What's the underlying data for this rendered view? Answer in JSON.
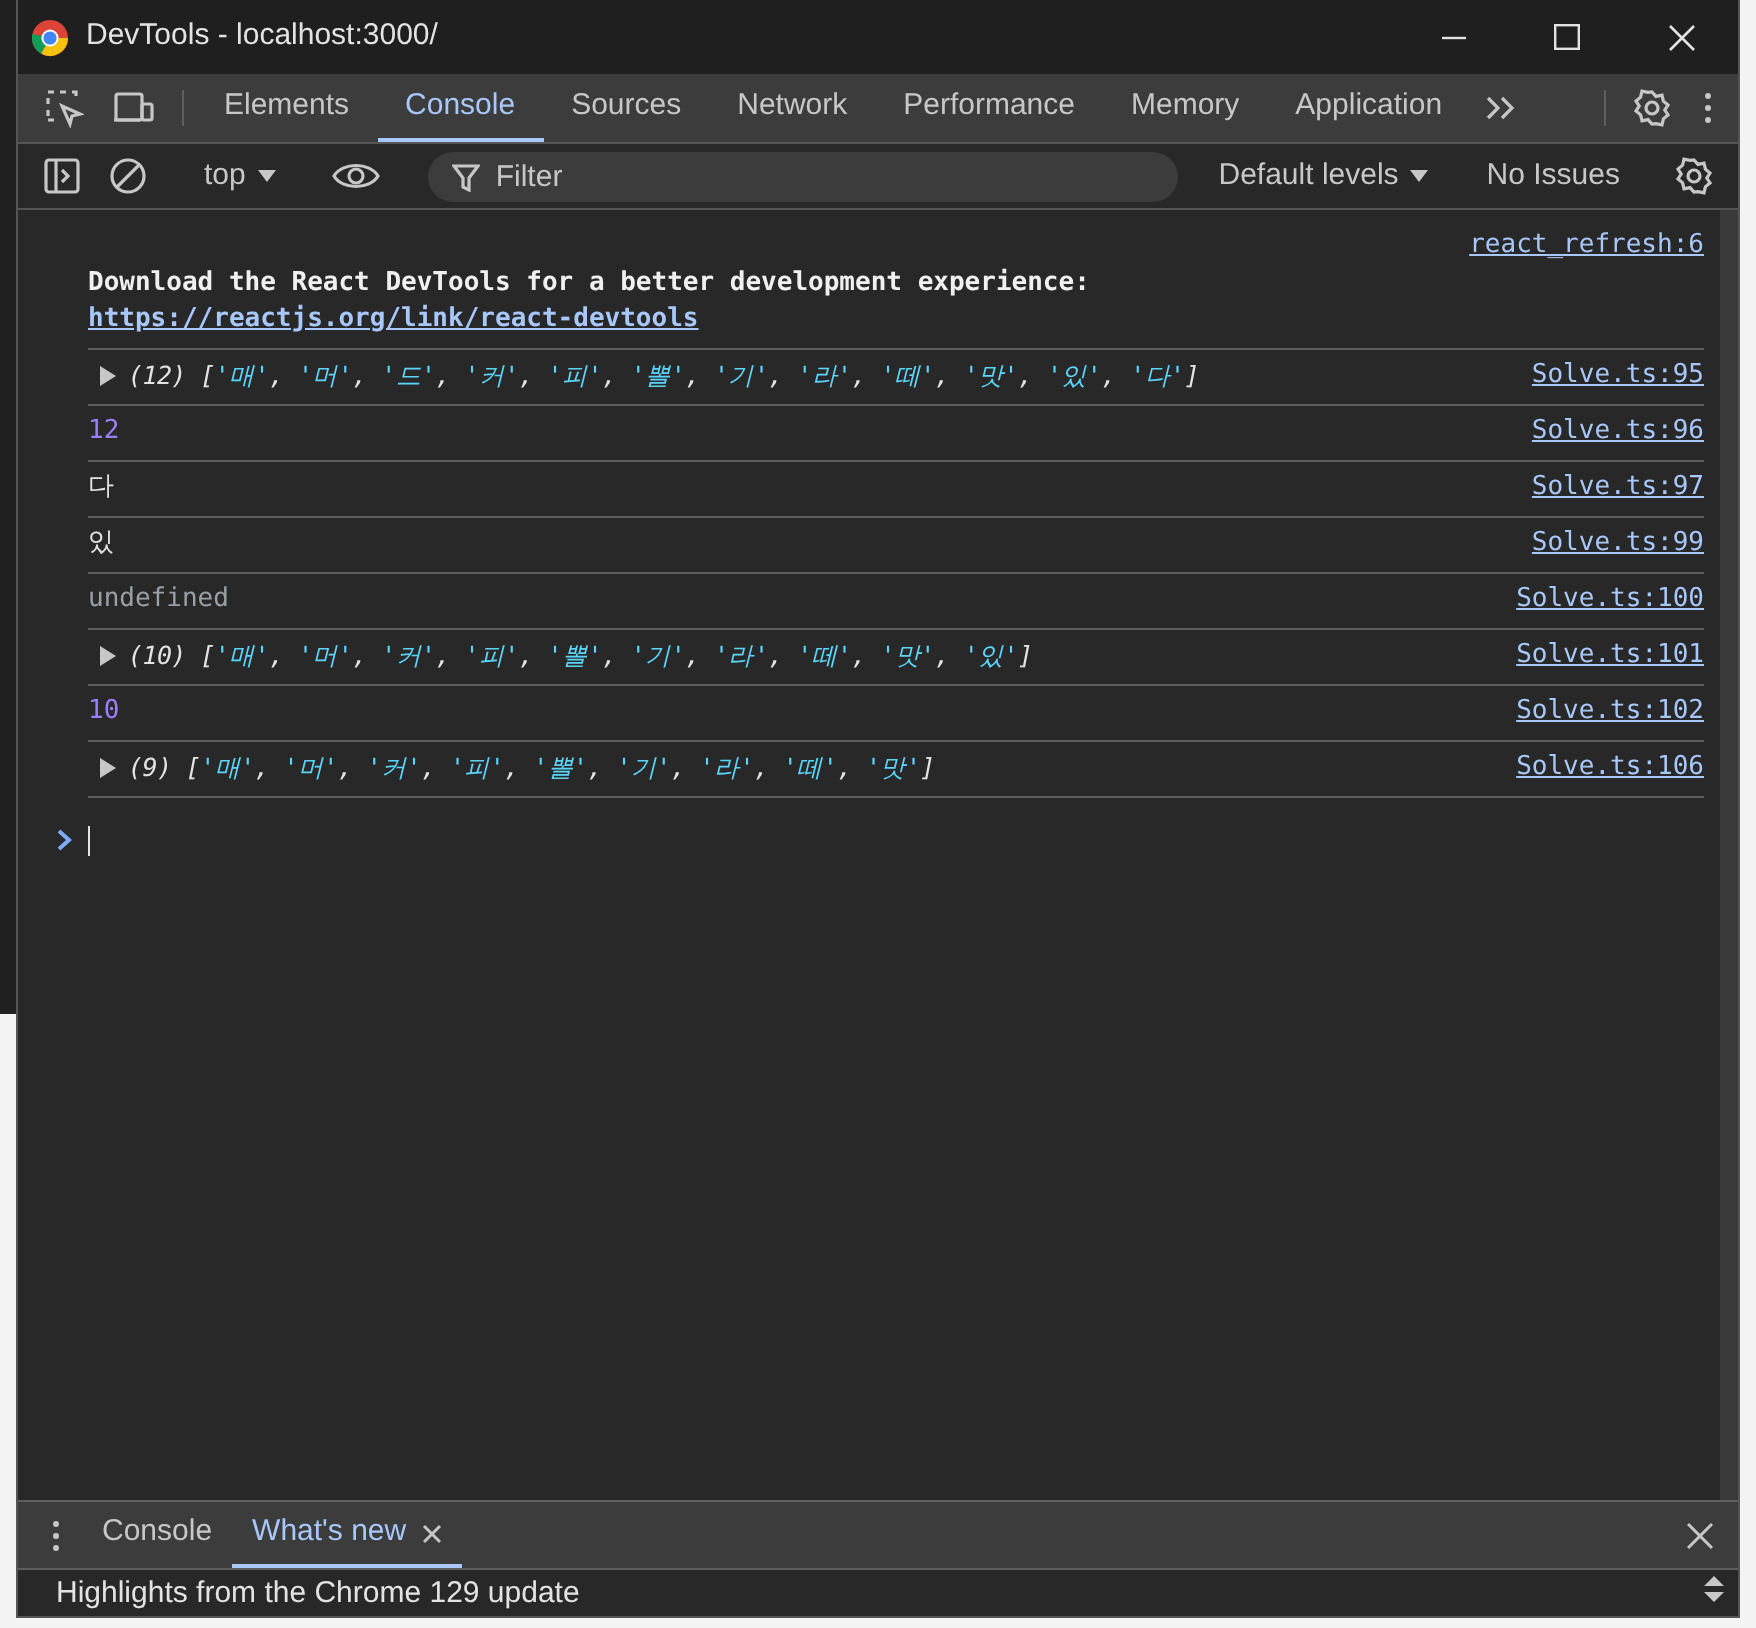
{
  "window": {
    "title": "DevTools - localhost:3000/"
  },
  "tabs": [
    {
      "label": "Elements",
      "selected": false
    },
    {
      "label": "Console",
      "selected": true
    },
    {
      "label": "Sources",
      "selected": false
    },
    {
      "label": "Network",
      "selected": false
    },
    {
      "label": "Performance",
      "selected": false
    },
    {
      "label": "Memory",
      "selected": false
    },
    {
      "label": "Application",
      "selected": false
    }
  ],
  "toolbar": {
    "context": "top",
    "filter": {
      "placeholder": "Filter"
    },
    "levels": "Default levels",
    "issues": "No Issues"
  },
  "console": {
    "entries": [
      {
        "kind": "message",
        "source": "react_refresh:6",
        "text": "Download the React DevTools for a better development experience:",
        "link": "https://reactjs.org/link/react-devtools"
      },
      {
        "kind": "array",
        "count": "(12)",
        "open": "[",
        "close": "]",
        "separator": ",",
        "items": [
          "'매'",
          "'머'",
          "'드'",
          "'커'",
          "'피'",
          "'뽈'",
          "'기'",
          "'라'",
          "'떼'",
          "'맛'",
          "'있'",
          "'다'"
        ],
        "source": "Solve.ts:95"
      },
      {
        "kind": "number",
        "text": "12",
        "source": "Solve.ts:96"
      },
      {
        "kind": "string",
        "text": "다",
        "source": "Solve.ts:97"
      },
      {
        "kind": "string",
        "text": "있",
        "source": "Solve.ts:99"
      },
      {
        "kind": "undefined",
        "text": "undefined",
        "source": "Solve.ts:100"
      },
      {
        "kind": "array",
        "count": "(10)",
        "open": "[",
        "close": "]",
        "separator": ",",
        "items": [
          "'매'",
          "'머'",
          "'커'",
          "'피'",
          "'뽈'",
          "'기'",
          "'라'",
          "'떼'",
          "'맛'",
          "'있'"
        ],
        "source": "Solve.ts:101"
      },
      {
        "kind": "number",
        "text": "10",
        "source": "Solve.ts:102"
      },
      {
        "kind": "array",
        "count": "(9)",
        "open": "[",
        "close": "]",
        "separator": ",",
        "items": [
          "'매'",
          "'머'",
          "'커'",
          "'피'",
          "'뽈'",
          "'기'",
          "'라'",
          "'떼'",
          "'맛'"
        ],
        "source": "Solve.ts:106"
      }
    ]
  },
  "drawer": {
    "tabs": [
      {
        "label": "Console",
        "selected": false,
        "closable": false
      },
      {
        "label": "What's new",
        "selected": true,
        "closable": true
      }
    ],
    "content": "Highlights from the Chrome 129 update"
  }
}
